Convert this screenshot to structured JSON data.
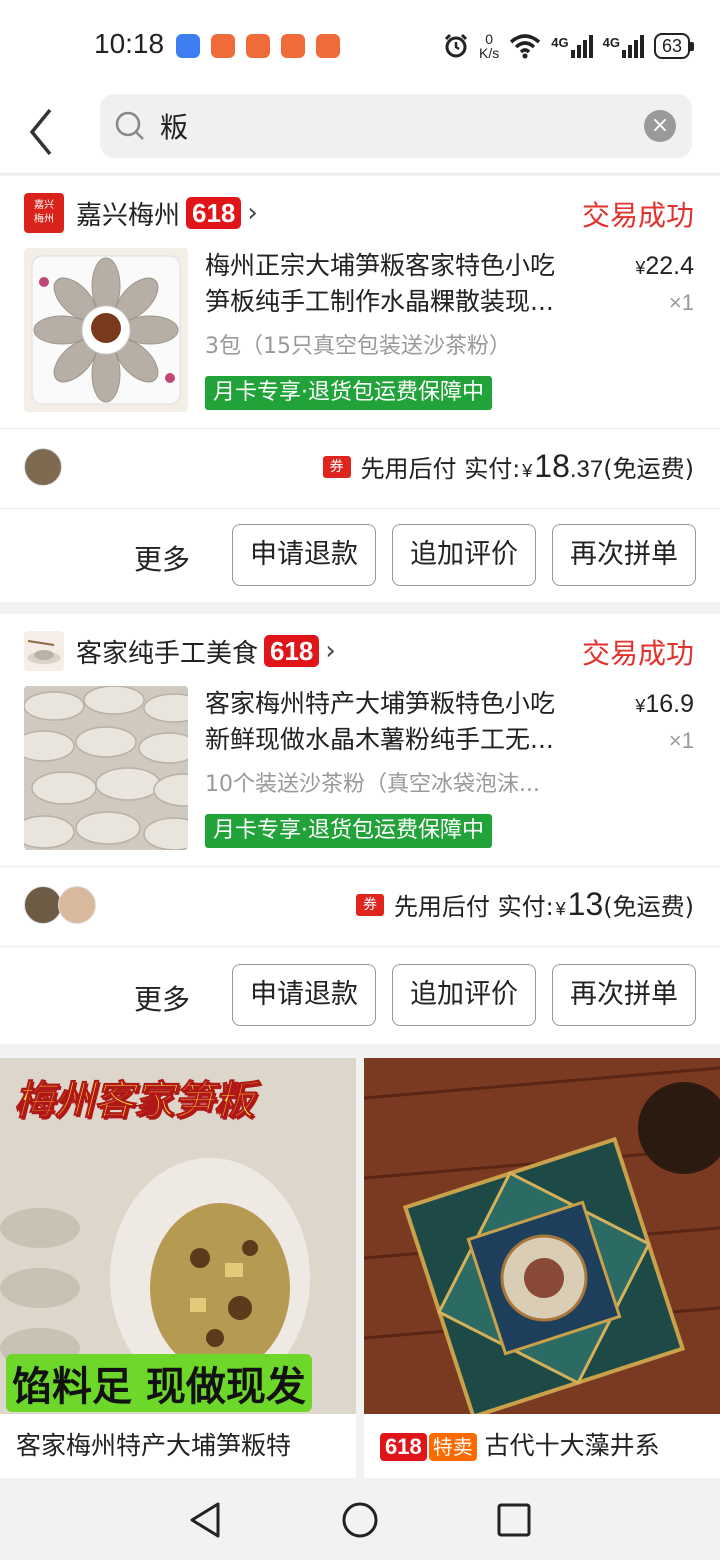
{
  "status_bar": {
    "time": "10:18",
    "net_speed_value": "0",
    "net_speed_unit": "K/s",
    "signal1": "4G",
    "signal2": "4G",
    "battery": "63"
  },
  "search": {
    "query": "粄"
  },
  "orders": [
    {
      "shop_logo_text": "嘉兴梅州",
      "shop_name": "嘉兴梅州",
      "badge": "618",
      "status": "交易成功",
      "title_line1": "梅州正宗大埔笋粄客家特色小吃",
      "title_line2": "笋板纯手工制作水晶粿散装现...",
      "price_symbol": "¥",
      "price": "22.4",
      "qty": "×1",
      "spec": "3包（15只真空包装送沙茶粉）",
      "promo": "月卡专享·退货包运费保障中",
      "coupon": "券",
      "pay_text": "先用后付 实付:",
      "pay_symbol": "¥",
      "pay_int": "18",
      "pay_dec": ".37",
      "shipping": "(免运费)",
      "more": "更多",
      "btn_refund": "申请退款",
      "btn_review": "追加评价",
      "btn_reorder": "再次拼单"
    },
    {
      "shop_name": "客家纯手工美食",
      "badge": "618",
      "status": "交易成功",
      "title_line1": "客家梅州特产大埔笋粄特色小吃",
      "title_line2": "新鲜现做水晶木薯粉纯手工无...",
      "price_symbol": "¥",
      "price": "16.9",
      "qty": "×1",
      "spec": "10个装送沙茶粉（真空冰袋泡沫...",
      "promo": "月卡专享·退货包运费保障中",
      "coupon": "券",
      "pay_text": "先用后付 实付:",
      "pay_symbol": "¥",
      "pay_int": "13",
      "pay_dec": "",
      "shipping": "(免运费)",
      "more": "更多",
      "btn_refund": "申请退款",
      "btn_review": "追加评价",
      "btn_reorder": "再次拼单"
    }
  ],
  "recommendations": [
    {
      "banner_top": "梅州客家笋粄",
      "banner_bottom": "馅料足 现做现发",
      "title": "客家梅州特产大埔笋粄特"
    },
    {
      "badge": "618",
      "badge2": "特卖",
      "title": "古代十大藻井系"
    }
  ],
  "colors": {
    "accent_red": "#e3312d",
    "promo_green": "#22a33a",
    "badge_red": "#e0151a"
  }
}
